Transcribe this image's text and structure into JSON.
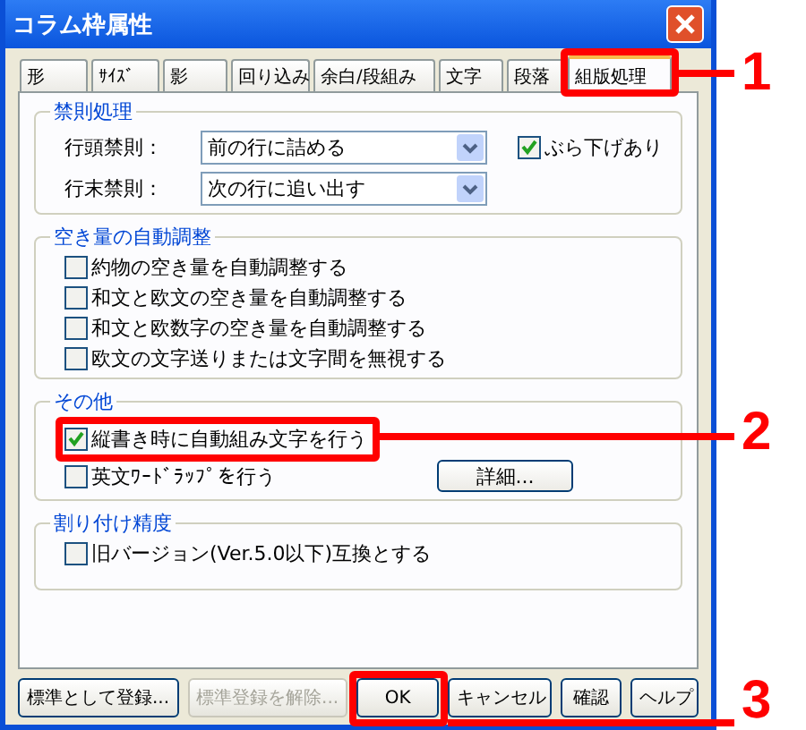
{
  "window": {
    "title": "コラム枠属性"
  },
  "tabs": [
    {
      "label": "形",
      "selected": false
    },
    {
      "label": "ｻｲｽﾞ",
      "selected": false
    },
    {
      "label": "影",
      "selected": false
    },
    {
      "label": "回り込み",
      "selected": false
    },
    {
      "label": "余白/段組み",
      "selected": false
    },
    {
      "label": "文字",
      "selected": false
    },
    {
      "label": "段落",
      "selected": false
    },
    {
      "label": "組版処理",
      "selected": true
    }
  ],
  "kinsoku": {
    "title": "禁則処理",
    "rows": [
      {
        "label": "行頭禁則：",
        "value": "前の行に詰める"
      },
      {
        "label": "行末禁則：",
        "value": "次の行に追い出す"
      }
    ],
    "option": {
      "label": "ぶら下げあり",
      "checked": true
    }
  },
  "groups": [
    {
      "title": "空き量の自動調整",
      "items": [
        {
          "label": "約物の空き量を自動調整する",
          "checked": false
        },
        {
          "label": "和文と欧文の空き量を自動調整する",
          "checked": false
        },
        {
          "label": "和文と欧数字の空き量を自動調整する",
          "checked": false
        },
        {
          "label": "欧文の文字送りまたは文字間を無視する",
          "checked": false
        }
      ]
    },
    {
      "title": "その他",
      "items": [
        {
          "label": "縦書き時に自動組み文字を行う",
          "checked": true
        },
        {
          "label": "英文ﾜｰﾄﾞﾗｯﾌﾟを行う",
          "checked": false
        }
      ],
      "button": "詳細..."
    },
    {
      "title": "割り付け精度",
      "items": [
        {
          "label": "旧バージョン(Ver.5.0以下)互換とする",
          "checked": false
        }
      ]
    }
  ],
  "buttons": [
    {
      "label": "標準として登録...",
      "disabled": false
    },
    {
      "label": "標準登録を解除...",
      "disabled": true
    },
    {
      "label": "OK",
      "disabled": false
    },
    {
      "label": "キャンセル",
      "disabled": false
    },
    {
      "label": "確認",
      "disabled": false
    },
    {
      "label": "ヘルプ",
      "disabled": false
    }
  ],
  "callouts": [
    {
      "number": "1"
    },
    {
      "number": "2"
    },
    {
      "number": "3"
    }
  ]
}
